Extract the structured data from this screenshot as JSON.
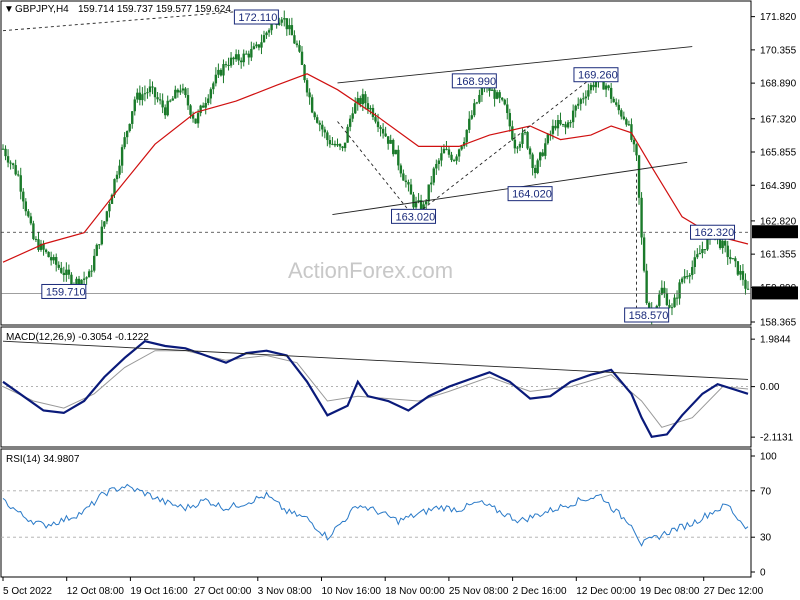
{
  "header": {
    "symbol": "GBPJPY,H4",
    "ohlc": "159.714 159.737 159.577 159.624"
  },
  "watermark": "ActionForex.com",
  "chart_data": [
    {
      "type": "candlestick",
      "panel": "price",
      "ylim": [
        158.365,
        172.2
      ],
      "y_ticks": [
        "171.820",
        "170.355",
        "168.890",
        "167.320",
        "165.855",
        "164.390",
        "162.820",
        "161.355",
        "159.890",
        "158.365"
      ],
      "x_ticks": [
        "5 Oct 2022",
        "12 Oct 08:00",
        "19 Oct 16:00",
        "27 Oct 00:00",
        "3 Nov 08:00",
        "10 Nov 16:00",
        "18 Nov 00:00",
        "25 Nov 08:00",
        "2 Dec 16:00",
        "12 Dec 00:00",
        "19 Dec 08:00",
        "27 Dec 12:00"
      ],
      "price_path": [
        [
          0,
          166.0
        ],
        [
          3,
          164.8
        ],
        [
          6,
          162.0
        ],
        [
          10,
          161.0
        ],
        [
          14,
          160.1
        ],
        [
          17,
          160.4
        ],
        [
          20,
          162.8
        ],
        [
          23,
          165.5
        ],
        [
          26,
          168.2
        ],
        [
          29,
          168.6
        ],
        [
          32,
          167.7
        ],
        [
          35,
          168.7
        ],
        [
          38,
          167.2
        ],
        [
          41,
          168.7
        ],
        [
          44,
          169.8
        ],
        [
          47,
          170.0
        ],
        [
          50,
          170.4
        ],
        [
          53,
          171.5
        ],
        [
          55,
          171.9
        ],
        [
          58,
          170.5
        ],
        [
          61,
          167.8
        ],
        [
          64,
          166.4
        ],
        [
          67,
          165.9
        ],
        [
          69,
          167.8
        ],
        [
          71,
          168.2
        ],
        [
          73,
          167.6
        ],
        [
          75,
          166.8
        ],
        [
          77,
          166.0
        ],
        [
          79,
          164.8
        ],
        [
          81,
          163.6
        ],
        [
          83,
          163.4
        ],
        [
          85,
          165.0
        ],
        [
          87,
          165.9
        ],
        [
          89,
          165.6
        ],
        [
          91,
          166.5
        ],
        [
          93,
          167.8
        ],
        [
          95,
          168.8
        ],
        [
          97,
          168.4
        ],
        [
          99,
          167.8
        ],
        [
          101,
          166.2
        ],
        [
          103,
          166.6
        ],
        [
          105,
          165.0
        ],
        [
          107,
          166.2
        ],
        [
          109,
          167.1
        ],
        [
          111,
          166.9
        ],
        [
          113,
          167.8
        ],
        [
          115,
          168.5
        ],
        [
          117,
          169.0
        ],
        [
          119,
          168.8
        ],
        [
          121,
          167.8
        ],
        [
          123,
          167.3
        ],
        [
          125,
          165.5
        ],
        [
          126,
          162.0
        ],
        [
          127,
          159.4
        ],
        [
          128,
          158.6
        ],
        [
          130,
          159.8
        ],
        [
          132,
          158.9
        ],
        [
          134,
          160.3
        ],
        [
          136,
          160.8
        ],
        [
          138,
          161.6
        ],
        [
          140,
          162.3
        ],
        [
          142,
          161.7
        ],
        [
          144,
          161.0
        ],
        [
          146,
          160.3
        ],
        [
          147,
          159.6
        ]
      ],
      "ma_path": [
        [
          0,
          161.0
        ],
        [
          8,
          161.8
        ],
        [
          16,
          162.3
        ],
        [
          22,
          164.0
        ],
        [
          30,
          166.2
        ],
        [
          38,
          167.6
        ],
        [
          46,
          168.1
        ],
        [
          54,
          168.8
        ],
        [
          60,
          169.3
        ],
        [
          66,
          168.6
        ],
        [
          74,
          167.4
        ],
        [
          82,
          166.1
        ],
        [
          90,
          166.1
        ],
        [
          96,
          166.6
        ],
        [
          104,
          167.0
        ],
        [
          110,
          166.4
        ],
        [
          116,
          166.6
        ],
        [
          120,
          167.0
        ],
        [
          124,
          166.7
        ],
        [
          128,
          165.2
        ],
        [
          134,
          163.0
        ],
        [
          140,
          162.2
        ],
        [
          147,
          161.8
        ]
      ],
      "horizontal_level": 162.32,
      "labels": [
        {
          "text": "172.110",
          "x": 50,
          "y": 172.11
        },
        {
          "text": "168.990",
          "x": 93,
          "y": 168.99
        },
        {
          "text": "169.260",
          "x": 117,
          "y": 169.26
        },
        {
          "text": "163.020",
          "x": 81,
          "y": 163.02
        },
        {
          "text": "164.020",
          "x": 104,
          "y": 164.02
        },
        {
          "text": "162.320",
          "x": 140,
          "y": 162.32
        },
        {
          "text": "159.710",
          "x": 12,
          "y": 159.71
        },
        {
          "text": "158.570",
          "x": 127,
          "y": 158.57
        }
      ],
      "current_price": "159.624",
      "level_label": "162.320"
    },
    {
      "type": "line",
      "panel": "macd",
      "title": "MACD(12,26,9) -0.3054 -0.1222",
      "ylim": [
        -2.4,
        2.2
      ],
      "y_ticks": [
        "1.9844",
        "0.00",
        "-2.1131"
      ],
      "macd_path": [
        [
          0,
          0.2
        ],
        [
          4,
          -0.4
        ],
        [
          8,
          -1.0
        ],
        [
          12,
          -1.1
        ],
        [
          16,
          -0.6
        ],
        [
          20,
          0.4
        ],
        [
          24,
          1.2
        ],
        [
          28,
          1.9
        ],
        [
          32,
          1.7
        ],
        [
          36,
          1.6
        ],
        [
          40,
          1.3
        ],
        [
          44,
          1.0
        ],
        [
          48,
          1.4
        ],
        [
          52,
          1.5
        ],
        [
          56,
          1.3
        ],
        [
          60,
          0.2
        ],
        [
          64,
          -1.2
        ],
        [
          68,
          -0.8
        ],
        [
          70,
          0.2
        ],
        [
          72,
          -0.4
        ],
        [
          76,
          -0.6
        ],
        [
          80,
          -1.0
        ],
        [
          84,
          -0.4
        ],
        [
          88,
          0.0
        ],
        [
          92,
          0.3
        ],
        [
          96,
          0.6
        ],
        [
          100,
          0.2
        ],
        [
          104,
          -0.5
        ],
        [
          108,
          -0.4
        ],
        [
          112,
          0.2
        ],
        [
          116,
          0.5
        ],
        [
          120,
          0.7
        ],
        [
          122,
          0.2
        ],
        [
          124,
          -0.3
        ],
        [
          126,
          -1.3
        ],
        [
          128,
          -2.1
        ],
        [
          131,
          -2.0
        ],
        [
          134,
          -1.2
        ],
        [
          138,
          -0.3
        ],
        [
          141,
          0.1
        ],
        [
          144,
          -0.1
        ],
        [
          147,
          -0.3
        ]
      ],
      "signal_path": [
        [
          0,
          0.0
        ],
        [
          6,
          -0.6
        ],
        [
          12,
          -0.9
        ],
        [
          18,
          -0.3
        ],
        [
          24,
          0.8
        ],
        [
          30,
          1.5
        ],
        [
          36,
          1.5
        ],
        [
          44,
          1.1
        ],
        [
          52,
          1.3
        ],
        [
          58,
          1.0
        ],
        [
          64,
          -0.6
        ],
        [
          70,
          -0.4
        ],
        [
          76,
          -0.5
        ],
        [
          82,
          -0.6
        ],
        [
          88,
          -0.2
        ],
        [
          96,
          0.4
        ],
        [
          104,
          -0.2
        ],
        [
          112,
          0.0
        ],
        [
          120,
          0.5
        ],
        [
          126,
          -0.6
        ],
        [
          130,
          -1.7
        ],
        [
          136,
          -1.3
        ],
        [
          142,
          0.0
        ],
        [
          147,
          -0.1
        ]
      ],
      "trendline": [
        [
          0,
          1.9
        ],
        [
          147,
          0.3
        ]
      ]
    },
    {
      "type": "line",
      "panel": "rsi",
      "title": "RSI(14) 34.9807",
      "ylim": [
        0,
        100
      ],
      "y_ticks": [
        "100",
        "70",
        "30",
        "0"
      ],
      "levels": [
        70,
        30
      ],
      "rsi_path": [
        [
          0,
          62
        ],
        [
          4,
          48
        ],
        [
          8,
          40
        ],
        [
          12,
          45
        ],
        [
          16,
          52
        ],
        [
          20,
          68
        ],
        [
          24,
          74
        ],
        [
          28,
          68
        ],
        [
          32,
          60
        ],
        [
          36,
          55
        ],
        [
          40,
          62
        ],
        [
          44,
          55
        ],
        [
          48,
          60
        ],
        [
          52,
          66
        ],
        [
          56,
          52
        ],
        [
          60,
          46
        ],
        [
          64,
          30
        ],
        [
          68,
          48
        ],
        [
          70,
          58
        ],
        [
          74,
          52
        ],
        [
          78,
          44
        ],
        [
          82,
          50
        ],
        [
          86,
          56
        ],
        [
          90,
          54
        ],
        [
          94,
          60
        ],
        [
          98,
          52
        ],
        [
          102,
          44
        ],
        [
          106,
          50
        ],
        [
          110,
          56
        ],
        [
          114,
          62
        ],
        [
          118,
          66
        ],
        [
          120,
          56
        ],
        [
          122,
          48
        ],
        [
          124,
          42
        ],
        [
          126,
          24
        ],
        [
          128,
          28
        ],
        [
          132,
          36
        ],
        [
          136,
          42
        ],
        [
          140,
          52
        ],
        [
          143,
          58
        ],
        [
          145,
          46
        ],
        [
          147,
          38
        ]
      ]
    }
  ]
}
